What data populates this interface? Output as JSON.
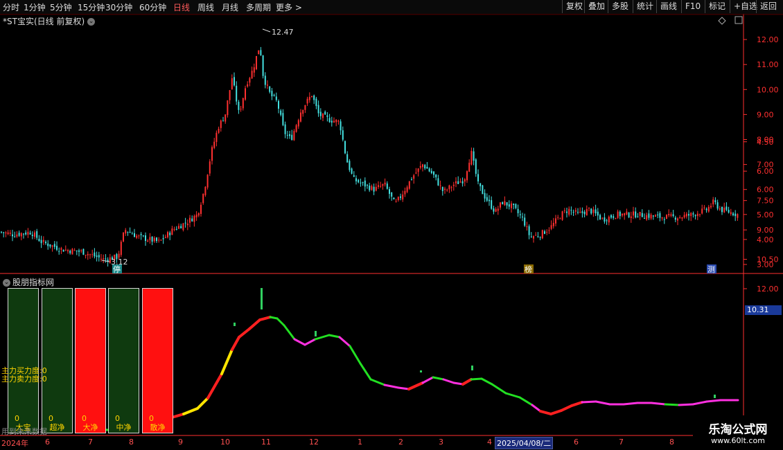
{
  "toolbar": {
    "periods": [
      "分时",
      "1分钟",
      "5分钟",
      "15分钟",
      "30分钟",
      "60分钟",
      "日线",
      "周线",
      "月线",
      "多周期",
      "更多 >"
    ],
    "active_period": "日线",
    "buttons": [
      "复权",
      "叠加",
      "多股",
      "统计",
      "画线",
      "F10",
      "标记",
      "+自选",
      "返回"
    ]
  },
  "main_chart": {
    "title": "*ST宝实(日线 前复权)",
    "high_marker": "12.47",
    "low_marker": "3.12",
    "y_ticks": [
      "12.00",
      "11.00",
      "10.00",
      "9.00",
      "8.00",
      "7.00",
      "6.00",
      "5.00",
      "4.00",
      "3.00"
    ],
    "badges": [
      "停",
      "榜",
      "测"
    ]
  },
  "indicator": {
    "title": "股朋指标网",
    "y_ticks": [
      "12.00",
      "10.50",
      "9.00",
      "7.50",
      "6.00",
      "4.50"
    ],
    "current_value": "10.31",
    "force_labels": [
      "主力买力度:0",
      "主力卖力度:0"
    ],
    "boxes": [
      {
        "name": "大宝",
        "value": "0",
        "color": "green"
      },
      {
        "name": "超净",
        "value": "0",
        "color": "green"
      },
      {
        "name": "大净",
        "value": "0",
        "color": "red"
      },
      {
        "name": "中净",
        "value": "0",
        "color": "green"
      },
      {
        "name": "散净",
        "value": "0",
        "color": "red"
      }
    ],
    "footer_note": "用到未来数据"
  },
  "dates": {
    "labels": [
      "2024年",
      "6",
      "7",
      "8",
      "9",
      "10",
      "11",
      "12",
      "1",
      "2",
      "3",
      "4",
      "6",
      "7",
      "8"
    ],
    "highlight": "2025/04/08/二"
  },
  "watermark": {
    "title": "乐淘公式网",
    "url": "www.60lt.com"
  },
  "colors": {
    "up": "#ff3030",
    "down": "#44e0e0",
    "axis": "#ff3030",
    "line_green": "#22e022",
    "line_magenta": "#ff30e0",
    "line_yellow": "#ffe400",
    "line_red": "#ff2020"
  }
}
